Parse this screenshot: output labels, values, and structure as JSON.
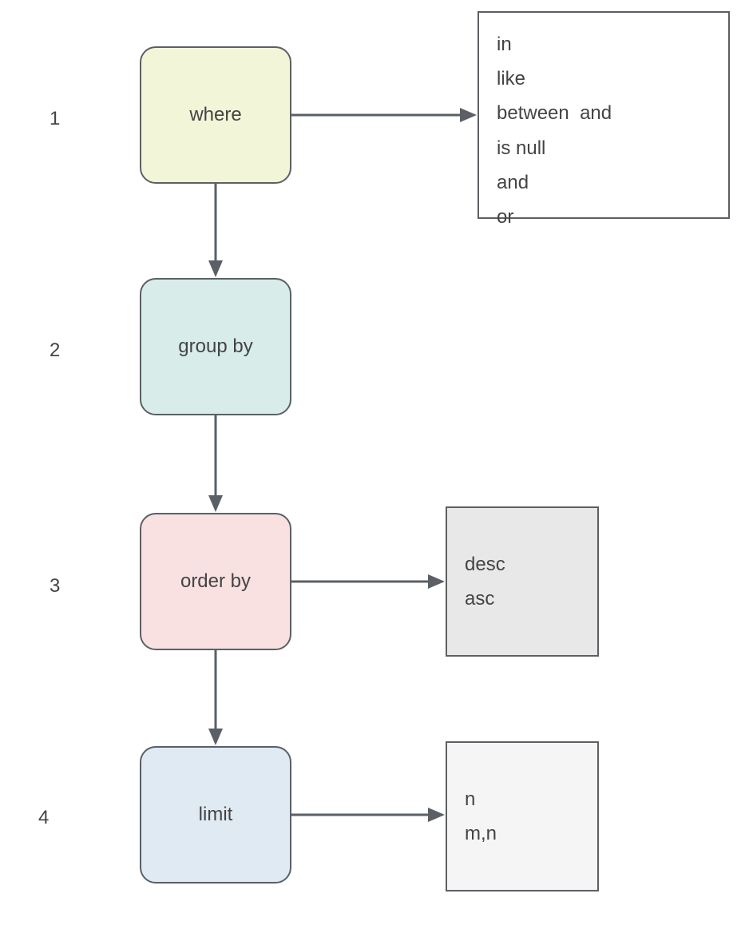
{
  "labels": {
    "n1": "1",
    "n2": "2",
    "n3": "3",
    "n4": "4"
  },
  "boxes": {
    "where": "where",
    "groupby": "group by",
    "orderby": "order by",
    "limit": "limit"
  },
  "panels": {
    "where_ops": [
      "in",
      "like",
      "between  and",
      "is null",
      "and",
      "or"
    ],
    "order_ops": [
      "desc",
      "asc"
    ],
    "limit_ops": [
      "n",
      "m,n"
    ]
  },
  "colors": {
    "where": "#f2f5d8",
    "groupby": "#d8edea",
    "orderby": "#f8e1e0",
    "limit": "#dfeaf3",
    "panel_order": "#e8e8e8",
    "panel_limit": "#f5f5f5",
    "panel_where": "#ffffff",
    "border": "#5b6066",
    "arrow": "#5b6066"
  }
}
